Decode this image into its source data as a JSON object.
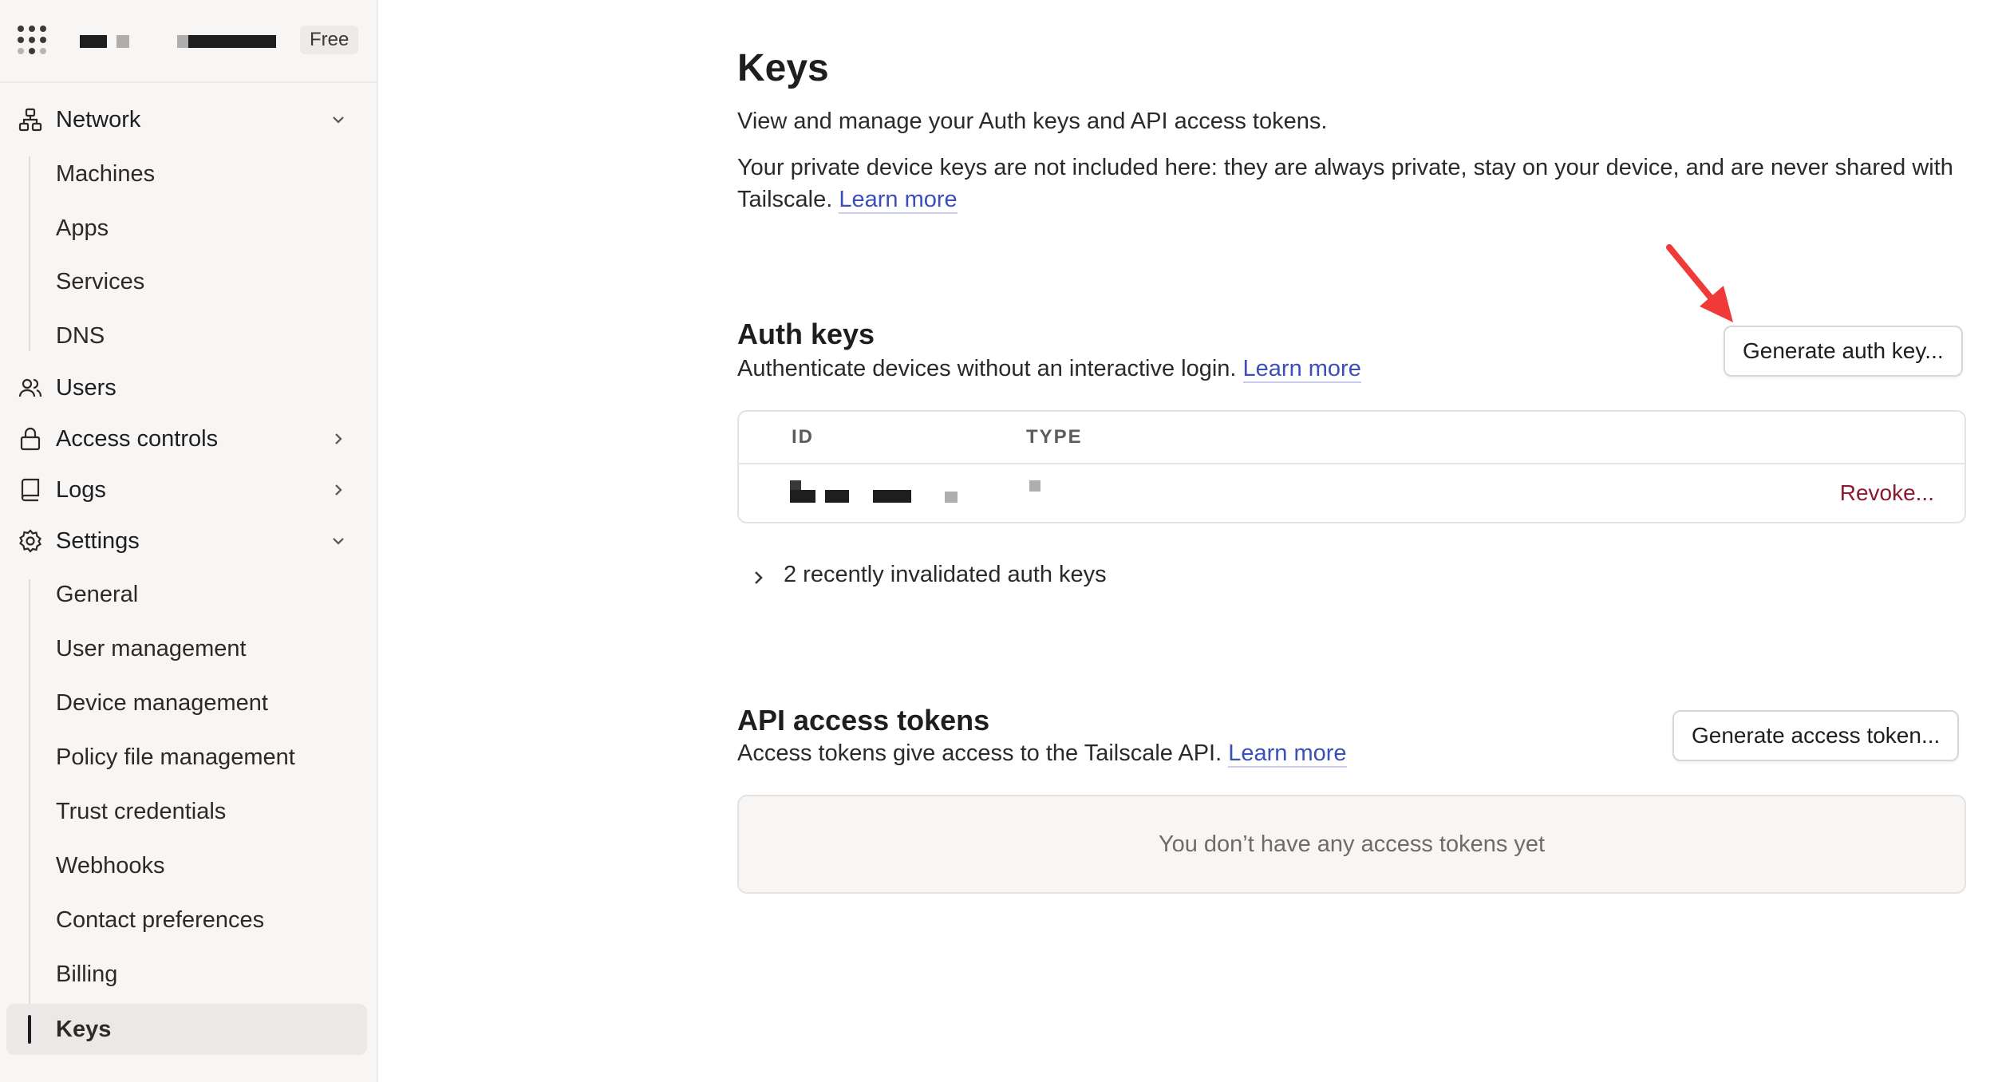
{
  "sidebar": {
    "plan_badge": "Free",
    "nav": {
      "network": "Network",
      "machines": "Machines",
      "apps": "Apps",
      "services": "Services",
      "dns": "DNS",
      "users": "Users",
      "access_controls": "Access controls",
      "logs": "Logs",
      "settings": "Settings",
      "general": "General",
      "user_management": "User management",
      "device_management": "Device management",
      "policy_file_management": "Policy file management",
      "trust_credentials": "Trust credentials",
      "webhooks": "Webhooks",
      "contact_preferences": "Contact preferences",
      "billing": "Billing",
      "keys": "Keys"
    }
  },
  "page": {
    "title": "Keys",
    "description": "View and manage your Auth keys and API access tokens.",
    "private_note": "Your private device keys are not included here: they are always private, stay on your device, and are never shared with Tailscale.",
    "learn_more": "Learn more"
  },
  "auth_keys": {
    "title": "Auth keys",
    "description": "Authenticate devices without an interactive login.",
    "learn_more": "Learn more",
    "generate_button": "Generate auth key...",
    "columns": {
      "id": "ID",
      "type": "TYPE"
    },
    "row_action": "Revoke...",
    "invalidated_toggle": "2 recently invalidated auth keys"
  },
  "api_tokens": {
    "title": "API access tokens",
    "description": "Access tokens give access to the Tailscale API.",
    "learn_more": "Learn more",
    "generate_button": "Generate access token...",
    "empty_message": "You don’t have any access tokens yet"
  },
  "colors": {
    "link": "#3b4fb8",
    "danger": "#8b1a2e",
    "annotation_arrow": "#f03a3a"
  }
}
